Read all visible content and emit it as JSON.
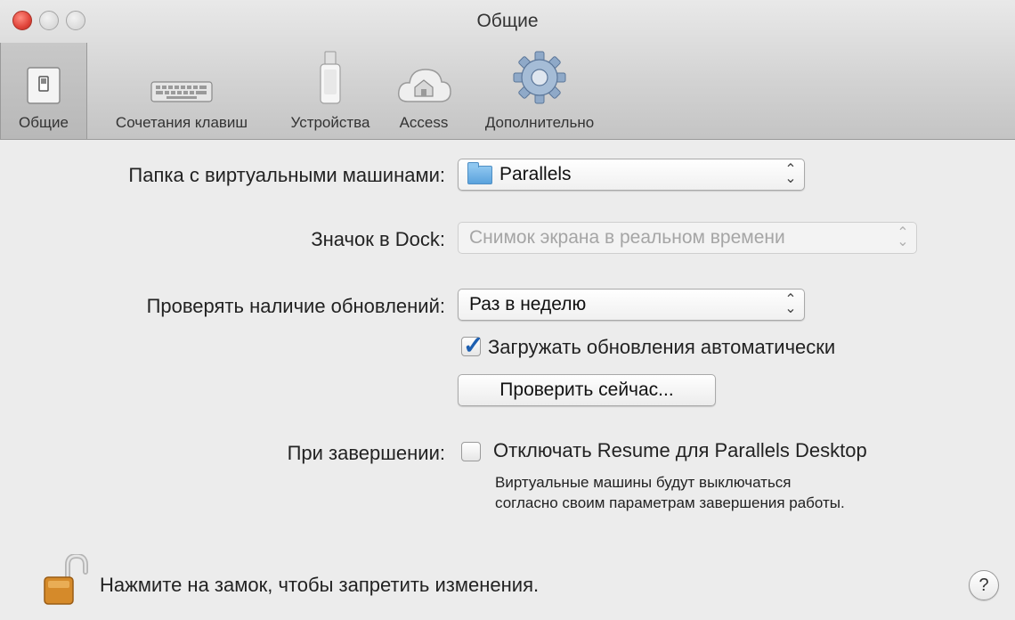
{
  "window": {
    "title": "Общие"
  },
  "toolbar": {
    "items": [
      {
        "label": "Общие",
        "icon": "general-switch-icon",
        "selected": true
      },
      {
        "label": "Сочетания клавиш",
        "icon": "keyboard-icon",
        "selected": false
      },
      {
        "label": "Устройства",
        "icon": "usb-device-icon",
        "selected": false
      },
      {
        "label": "Access",
        "icon": "cloud-home-icon",
        "selected": false
      },
      {
        "label": "Дополнительно",
        "icon": "gear-icon",
        "selected": false
      }
    ]
  },
  "settings": {
    "vm_folder": {
      "label": "Папка с виртуальными машинами:",
      "value": "Parallels",
      "icon": "folder-icon"
    },
    "dock_icon": {
      "label": "Значок в Dock:",
      "value": "Снимок экрана в реальном времени",
      "disabled": true
    },
    "updates": {
      "label": "Проверять наличие обновлений:",
      "value": "Раз в неделю",
      "auto_download_label": "Загружать обновления автоматически",
      "auto_download_checked": true,
      "check_now_label": "Проверить сейчас..."
    },
    "on_quit": {
      "label": "При завершении:",
      "checkbox_label": "Отключать Resume для Parallels Desktop",
      "checked": false,
      "note_line1": "Виртуальные машины будут выключаться",
      "note_line2": "согласно своим параметрам завершения работы."
    }
  },
  "footer": {
    "lock_text": "Нажмите на замок, чтобы запретить изменения.",
    "lock_icon": "open-lock-icon",
    "help_label": "?"
  },
  "colors": {
    "close": "#e0443a",
    "folder": "#5aa2dd",
    "checkmark": "#1d5fb0",
    "lock": "#d58a2a"
  }
}
